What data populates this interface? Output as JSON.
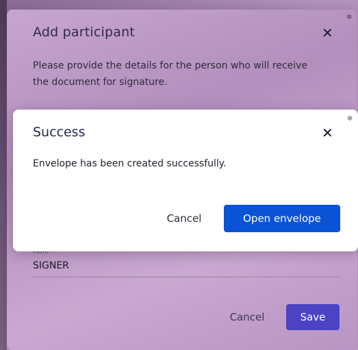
{
  "add_participant_dialog": {
    "title": "Add participant",
    "close_icon": "close-icon",
    "gear_icon": "gear-icon",
    "description": "Please provide the details for the person who will receive the document for signature.",
    "role_label": "Role",
    "role_value": "SIGNER",
    "cancel_label": "Cancel",
    "save_label": "Save",
    "save_color": "#4a43c4"
  },
  "success_dialog": {
    "title": "Success",
    "close_icon": "close-icon",
    "gear_icon": "gear-icon",
    "message": "Envelope has been created successfully.",
    "cancel_label": "Cancel",
    "open_label": "Open envelope",
    "open_color": "#0a53d6"
  }
}
